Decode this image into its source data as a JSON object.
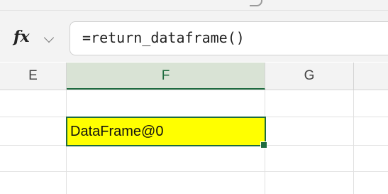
{
  "formula_bar": {
    "fx_label": "fx",
    "formula": "=return_dataframe()"
  },
  "columns": [
    {
      "label": "E",
      "selected": false
    },
    {
      "label": "F",
      "selected": true
    },
    {
      "label": "G",
      "selected": false
    }
  ],
  "active_cell": {
    "column": "F",
    "value": "DataFrame@0",
    "fill_color": "#ffff00",
    "border_color": "#1e6b3f"
  },
  "colors": {
    "selected_header_bg": "#d9e3d5",
    "selected_header_text": "#1e6b3f"
  }
}
